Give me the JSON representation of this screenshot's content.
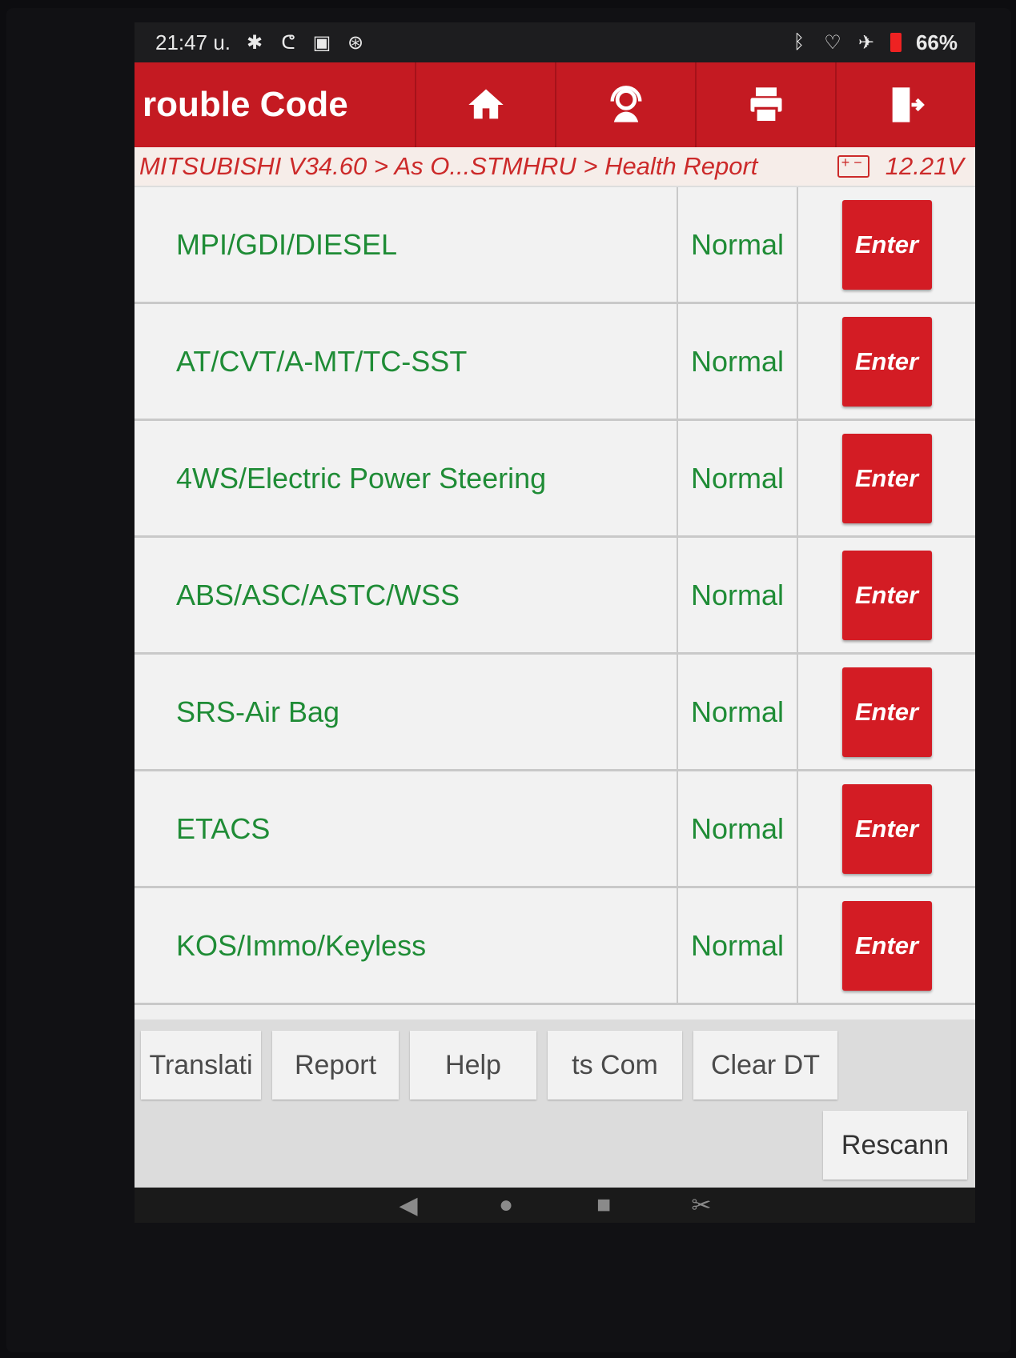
{
  "status_bar": {
    "time": "21:47",
    "period": "u.",
    "battery_percent": "66%"
  },
  "header": {
    "title": "rouble Code",
    "tools": [
      {
        "icon": "home-icon"
      },
      {
        "icon": "support-agent-icon"
      },
      {
        "icon": "printer-icon"
      },
      {
        "icon": "exit-icon"
      }
    ]
  },
  "breadcrumb": {
    "path": "MITSUBISHI V34.60 > As O...STMHRU > Health Report",
    "voltage": "12.21V"
  },
  "systems": [
    {
      "name": "MPI/GDI/DIESEL",
      "status": "Normal",
      "action": "Enter"
    },
    {
      "name": "AT/CVT/A-MT/TC-SST",
      "status": "Normal",
      "action": "Enter"
    },
    {
      "name": "4WS/Electric Power Steering",
      "status": "Normal",
      "action": "Enter"
    },
    {
      "name": "ABS/ASC/ASTC/WSS",
      "status": "Normal",
      "action": "Enter"
    },
    {
      "name": "SRS-Air Bag",
      "status": "Normal",
      "action": "Enter"
    },
    {
      "name": "ETACS",
      "status": "Normal",
      "action": "Enter"
    },
    {
      "name": "KOS/Immo/Keyless",
      "status": "Normal",
      "action": "Enter"
    }
  ],
  "footer": {
    "translate": "Translati",
    "report": "Report",
    "help": "Help",
    "comparison": "ts    Com",
    "clear_dtc": "Clear DT",
    "rescan": "Rescann"
  },
  "colors": {
    "accent": "#c41a22",
    "ok_green": "#1f8c36"
  }
}
